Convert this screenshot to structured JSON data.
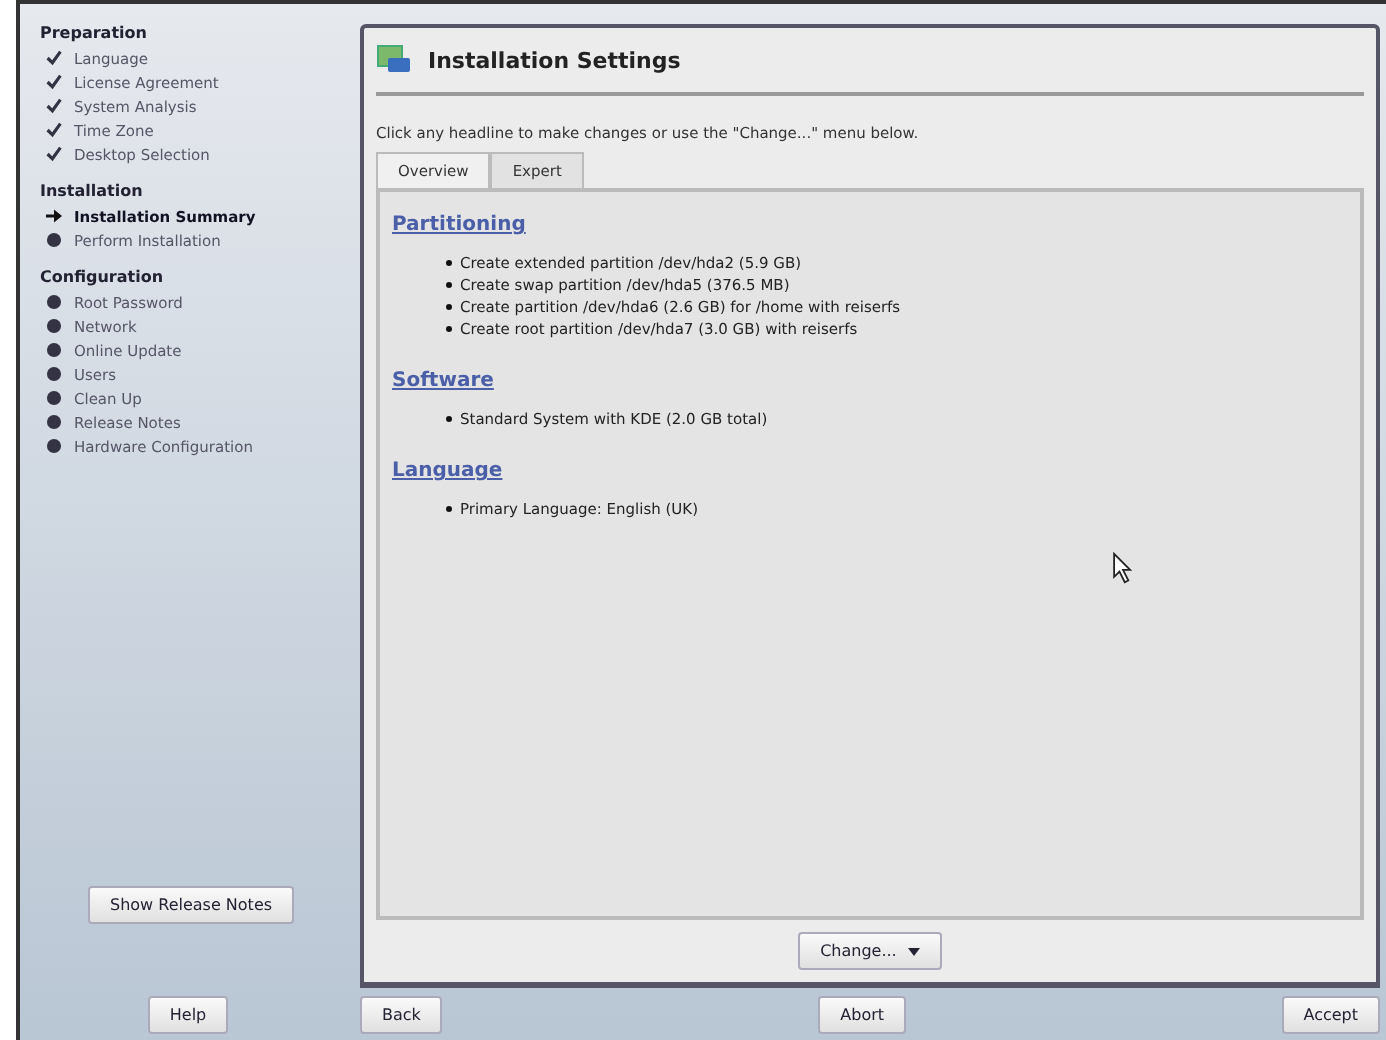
{
  "sidebar": {
    "sections": [
      {
        "title": "Preparation",
        "items": [
          {
            "label": "Language",
            "kind": "done"
          },
          {
            "label": "License Agreement",
            "kind": "done"
          },
          {
            "label": "System Analysis",
            "kind": "done"
          },
          {
            "label": "Time Zone",
            "kind": "done"
          },
          {
            "label": "Desktop Selection",
            "kind": "done"
          }
        ]
      },
      {
        "title": "Installation",
        "items": [
          {
            "label": "Installation Summary",
            "kind": "current"
          },
          {
            "label": "Perform Installation",
            "kind": "pending"
          }
        ]
      },
      {
        "title": "Configuration",
        "items": [
          {
            "label": "Root Password",
            "kind": "pending"
          },
          {
            "label": "Network",
            "kind": "pending"
          },
          {
            "label": "Online Update",
            "kind": "pending"
          },
          {
            "label": "Users",
            "kind": "pending"
          },
          {
            "label": "Clean Up",
            "kind": "pending"
          },
          {
            "label": "Release Notes",
            "kind": "pending"
          },
          {
            "label": "Hardware Configuration",
            "kind": "pending"
          }
        ]
      }
    ],
    "release_notes_button": "Show Release Notes"
  },
  "panel": {
    "title": "Installation Settings",
    "hint": "Click any headline to make changes or use the \"Change...\" menu below.",
    "tabs": [
      {
        "label": "Overview",
        "selected": true
      },
      {
        "label": "Expert",
        "selected": false
      }
    ],
    "sections": [
      {
        "heading": "Partitioning",
        "items": [
          "Create extended partition /dev/hda2 (5.9 GB)",
          "Create swap partition /dev/hda5 (376.5 MB)",
          "Create partition /dev/hda6 (2.6 GB) for /home with reiserfs",
          "Create root partition /dev/hda7 (3.0 GB) with reiserfs"
        ]
      },
      {
        "heading": "Software",
        "items": [
          "Standard System with KDE (2.0 GB total)"
        ]
      },
      {
        "heading": "Language",
        "items": [
          "Primary Language: English (UK)"
        ]
      }
    ],
    "change_button": "Change..."
  },
  "buttons": {
    "help": "Help",
    "back": "Back",
    "abort": "Abort",
    "accept": "Accept"
  }
}
